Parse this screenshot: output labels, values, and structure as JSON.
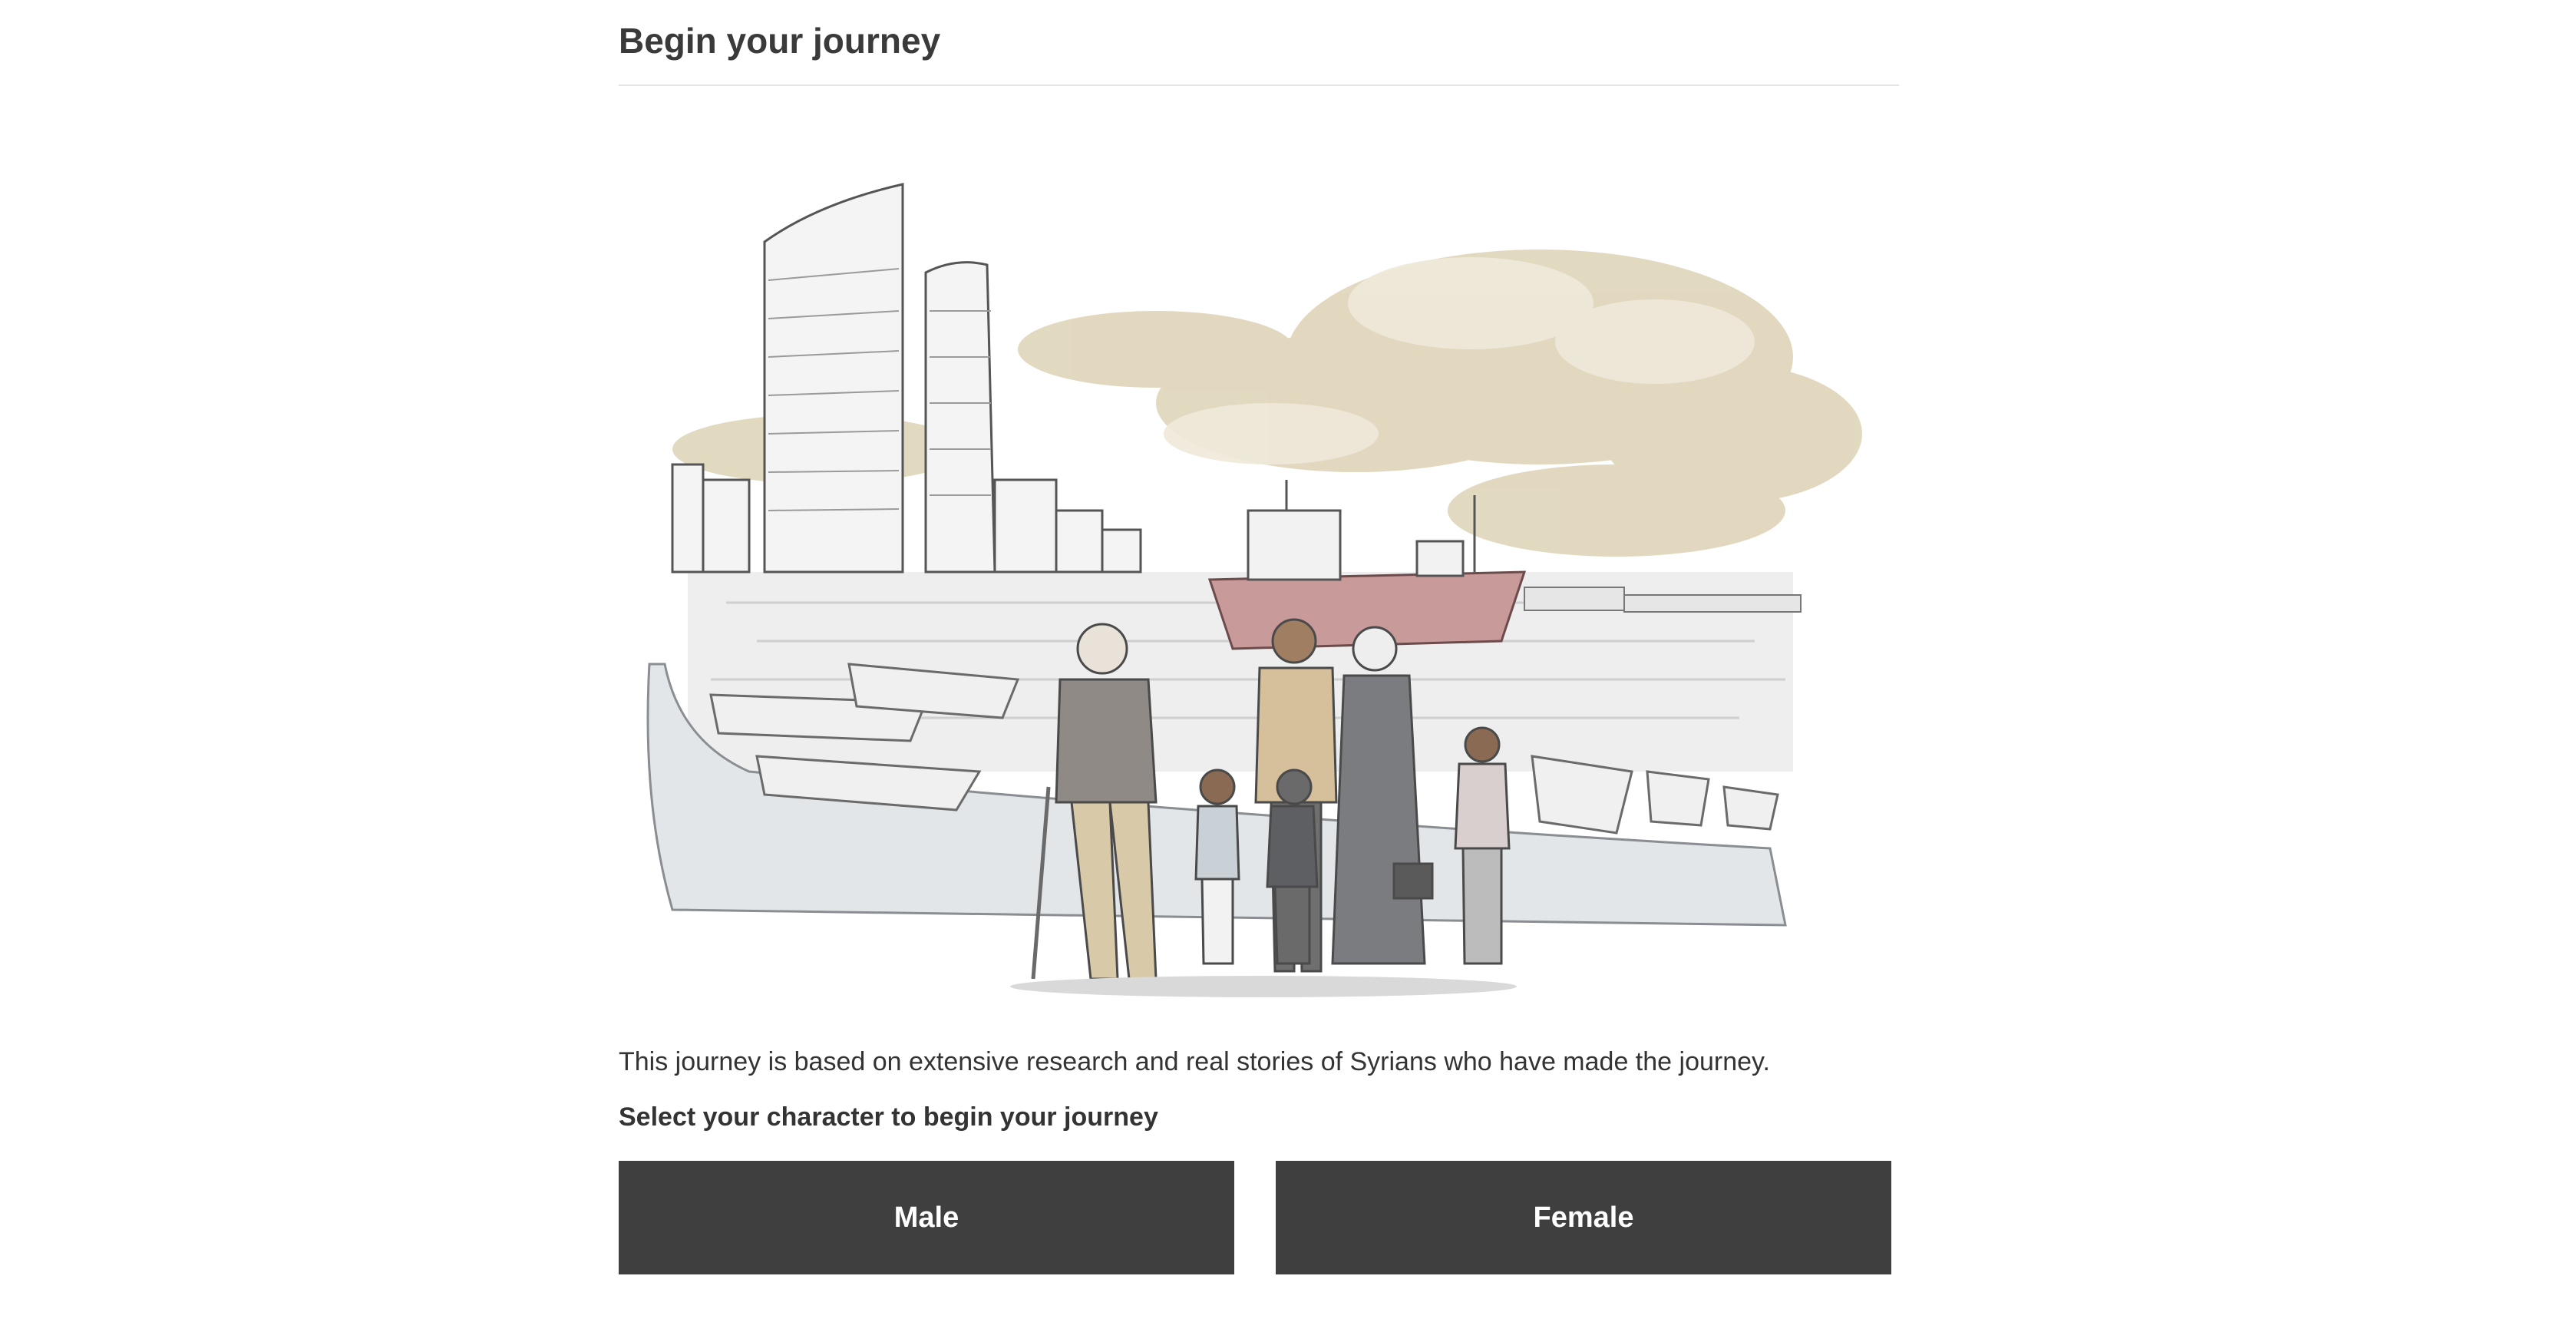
{
  "page": {
    "title": "Begin your journey",
    "intro": "This journey is based on extensive research and real stories of Syrians who have made the journey.",
    "select_prompt": "Select your character to begin your journey"
  },
  "illustration": {
    "subject": "harbour-city-with-family-illustration"
  },
  "characters": {
    "male_label": "Male",
    "female_label": "Female"
  },
  "colors": {
    "button_bg": "#3f3f3f",
    "button_text": "#ffffff",
    "sky_wash": "#d9cdb0",
    "ship_hull": "#b98a8a"
  }
}
